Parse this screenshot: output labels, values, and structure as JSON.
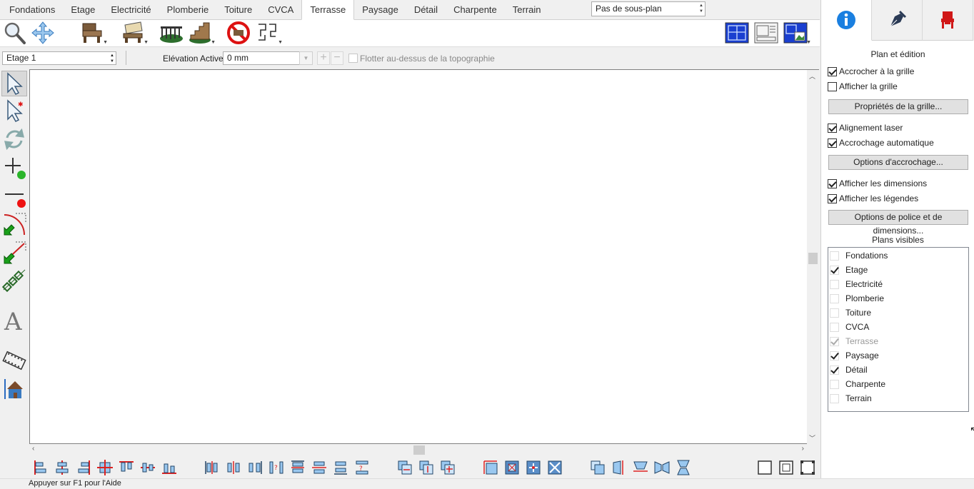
{
  "tabs": [
    {
      "label": "Fondations",
      "active": false
    },
    {
      "label": "Etage",
      "active": false
    },
    {
      "label": "Electricité",
      "active": false
    },
    {
      "label": "Plomberie",
      "active": false
    },
    {
      "label": "Toiture",
      "active": false
    },
    {
      "label": "CVCA",
      "active": false
    },
    {
      "label": "Terrasse",
      "active": true
    },
    {
      "label": "Paysage",
      "active": false
    },
    {
      "label": "Détail",
      "active": false
    },
    {
      "label": "Charpente",
      "active": false
    },
    {
      "label": "Terrain",
      "active": false
    }
  ],
  "subplan": {
    "value": "Pas de sous-plan"
  },
  "levelbar": {
    "level": "Etage 1",
    "elevation_label": "Elévation Active:",
    "elevation_value": "0 mm",
    "float_label": "Flotter au-dessus de la topographie"
  },
  "toolbar_icons": [
    "zoom-icon",
    "pan-icon",
    "deck-chair-icon",
    "deck-bench-icon",
    "railing-icon",
    "stairs-icon",
    "no-entry-icon",
    "path-icon",
    "plan-view-blue-icon",
    "plan-view-sheet-icon",
    "plan-view-image-icon"
  ],
  "left_tools": [
    "select-arrow-icon",
    "select-special-icon",
    "rotate-icon",
    "add-point-icon",
    "remove-point-icon",
    "curve-arc-icon",
    "curve-line-icon",
    "chain-icon",
    "text-icon",
    "film-icon",
    "house-icon"
  ],
  "status": {
    "text": "Appuyer sur F1 pour l'Aide"
  },
  "rightpanel": {
    "heading": "Plan et édition",
    "snap_grid": {
      "label": "Accrocher à la grille",
      "checked": true
    },
    "show_grid": {
      "label": "Afficher la grille",
      "checked": false
    },
    "grid_props_button": "Propriétés de la grille...",
    "laser": {
      "label": "Alignement laser",
      "checked": true
    },
    "auto_snap": {
      "label": "Accrochage automatique",
      "checked": true
    },
    "snap_options_button": "Options d'accrochage...",
    "show_dims": {
      "label": "Afficher les dimensions",
      "checked": true
    },
    "show_legends": {
      "label": "Afficher les légendes",
      "checked": true
    },
    "font_dims_button": "Options de police et de dimensions...",
    "plans_heading": "Plans visibles",
    "plans": [
      {
        "label": "Fondations",
        "checked": false,
        "disabled": false
      },
      {
        "label": "Etage",
        "checked": true,
        "disabled": false
      },
      {
        "label": "Electricité",
        "checked": false,
        "disabled": false
      },
      {
        "label": "Plomberie",
        "checked": false,
        "disabled": false
      },
      {
        "label": "Toiture",
        "checked": false,
        "disabled": false
      },
      {
        "label": "CVCA",
        "checked": false,
        "disabled": false
      },
      {
        "label": "Terrasse",
        "checked": true,
        "disabled": true
      },
      {
        "label": "Paysage",
        "checked": true,
        "disabled": false
      },
      {
        "label": "Détail",
        "checked": true,
        "disabled": false
      },
      {
        "label": "Charpente",
        "checked": false,
        "disabled": false
      },
      {
        "label": "Terrain",
        "checked": false,
        "disabled": false
      }
    ]
  }
}
